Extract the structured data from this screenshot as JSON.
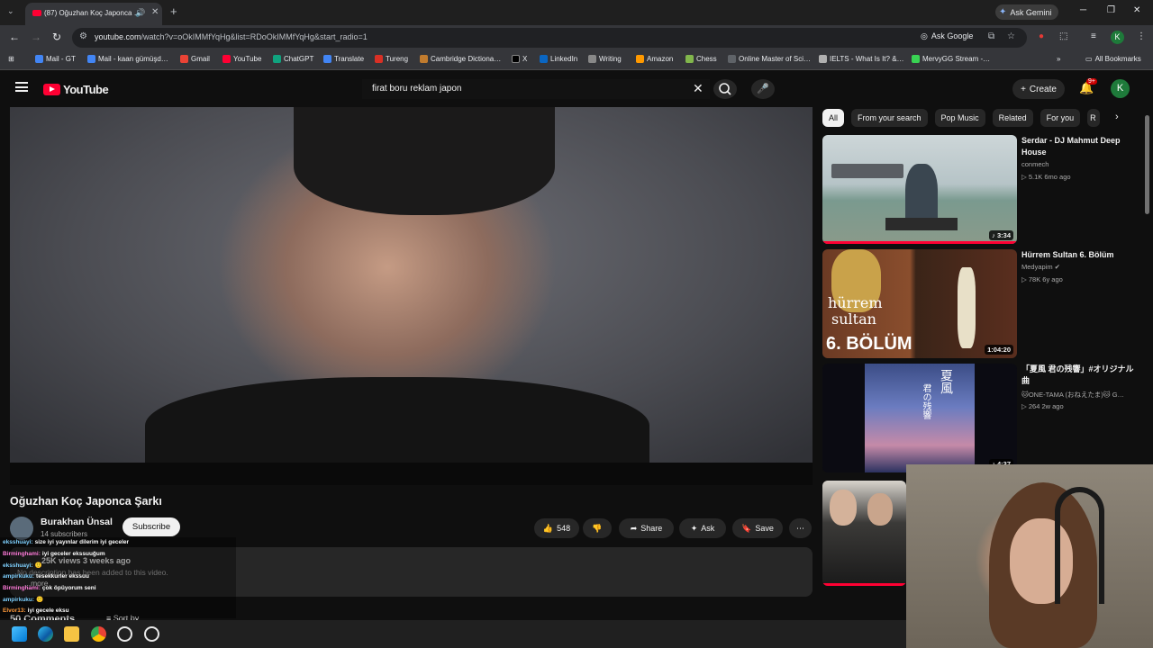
{
  "browser": {
    "tab_title": "(87) Oğuzhan Koç Japonca …",
    "tab_close": "✕",
    "new_tab": "+",
    "gemini_label": "Ask Gemini",
    "url_host": "youtube.com",
    "url_path": "/watch?v=oOkIMMfYqHg&list=RDoOkIMMfYqHg&start_radio=1",
    "ask_google": "Ask Google",
    "profile_initial": "K",
    "bookmarks": [
      {
        "label": "Mail - GT",
        "color": "#4285f4"
      },
      {
        "label": "Mail - kaan gümüşd…",
        "color": "#4285f4"
      },
      {
        "label": "Gmail",
        "color": "#ea4335"
      },
      {
        "label": "YouTube",
        "color": "#ff0033"
      },
      {
        "label": "ChatGPT",
        "color": "#10a37f"
      },
      {
        "label": "Translate",
        "color": "#4285f4"
      },
      {
        "label": "Tureng",
        "color": "#d93025"
      },
      {
        "label": "Cambridge Dictiona…",
        "color": "#c07b2e"
      },
      {
        "label": "X",
        "color": "#000000"
      },
      {
        "label": "LinkedIn",
        "color": "#0a66c2"
      },
      {
        "label": "Writing",
        "color": "#888888"
      },
      {
        "label": "Amazon",
        "color": "#ff9900"
      },
      {
        "label": "Chess",
        "color": "#81b64c"
      },
      {
        "label": "Online Master of Sci…",
        "color": "#5f6368"
      },
      {
        "label": "IELTS - What Is It? &…",
        "color": "#b0b0b0"
      },
      {
        "label": "MervyGG Stream -…",
        "color": "#39d353"
      }
    ],
    "all_bookmarks": "All Bookmarks"
  },
  "youtube": {
    "logo_text": "YouTube",
    "search_query": "firat boru reklam japon",
    "create_label": "Create",
    "notif_count": "9+",
    "avatar_initial": "K"
  },
  "video": {
    "title": "Oğuzhan Koç Japonca Şarkı",
    "channel": "Burakhan Ünsal",
    "subscribers": "14 subscribers",
    "subscribe_label": "Subscribe",
    "likes": "548",
    "share_label": "Share",
    "ask_label": "Ask",
    "save_label": "Save",
    "views_date": "25K views  3 weeks ago",
    "no_description": "No description has been added to this video.",
    "more_label": "...more",
    "comments_heading": "50 Comments",
    "sort_label": "Sort by"
  },
  "chat": [
    {
      "user": "eksshuayi:",
      "msg": "size iyi yayınlar dilerim iyi geceler",
      "color": "#7fd1ff"
    },
    {
      "user": "Birminghami:",
      "msg": "iyi geceler ekssuuğum",
      "color": "#ff7ad9"
    },
    {
      "user": "eksshuayi:",
      "msg": "🙂",
      "color": "#7fd1ff"
    },
    {
      "user": "ampirkuku:",
      "msg": "tesekkurler ekssuu",
      "color": "#7fd1ff"
    },
    {
      "user": "Birminghami:",
      "msg": "çok öpüyorum seni",
      "color": "#ff7ad9"
    },
    {
      "user": "ampirkuku:",
      "msg": "🙂",
      "color": "#7fd1ff"
    },
    {
      "user": "Elvor13:",
      "msg": "iyi gecele eksu",
      "color": "#ff9a3c"
    }
  ],
  "sidebar": {
    "chips": [
      "All",
      "From your search",
      "Pop Music",
      "Related",
      "For you",
      "R"
    ],
    "recommendations": [
      {
        "title": "Serdar - DJ Mahmut Deep House",
        "channel": "conmech",
        "stats": "▷ 5.1K  6mo ago",
        "duration": "♪ 3:34"
      },
      {
        "title": "Hürrem Sultan 6. Bölüm",
        "channel": "Medyapim ✔",
        "stats": "▷ 78K  6y ago",
        "duration": "1:04:20",
        "thumb_text_1": "hürrem",
        "thumb_text_2": "sultan",
        "thumb_text_3": "6. BÖLÜM"
      },
      {
        "title": "「夏風 君の残響」#オリジナル曲",
        "channel": "🐱ONE-TAMA (おねえたま)🐱 G…",
        "stats": "▷ 264  2w ago",
        "duration": "♪ 4:37",
        "thumb_text_1": "夏風",
        "thumb_text_2": "君の残響"
      },
      {
        "title": "",
        "channel": "",
        "stats": "",
        "duration": ""
      }
    ]
  }
}
